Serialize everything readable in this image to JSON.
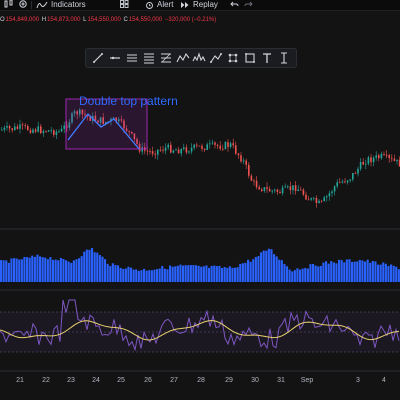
{
  "toolbar": {
    "indicators_label": "Indicators",
    "alert_label": "Alert",
    "replay_label": "Replay"
  },
  "ohlc": {
    "o_label": "O",
    "o_value": "154,849,000",
    "h_label": "H",
    "h_value": "154,873,000",
    "l_label": "L",
    "l_value": "154,550,000",
    "c_label": "C",
    "c_value": "154,550,000",
    "change": "−320,000 (−0.21%)"
  },
  "drawing_tools": [
    "cursor-icon",
    "trend-line-icon",
    "horizontal-ray-icon",
    "parallel-channel-icon",
    "fib-retracement-icon",
    "zigzag-pattern-icon",
    "head-shoulders-icon",
    "path-icon",
    "points-icon",
    "rectangle-icon",
    "text-icon",
    "pin-icon"
  ],
  "annotation": {
    "label": "Double top pattern",
    "color": "#2f6bff",
    "box_color": "#9c27b0"
  },
  "x_axis": {
    "labels": [
      "21",
      "22",
      "23",
      "24",
      "25",
      "26",
      "27",
      "28",
      "29",
      "30",
      "31",
      "Sep",
      "3",
      "4"
    ]
  },
  "colors": {
    "up": "#26a69a",
    "down": "#ef5350",
    "volume": "#2962ff",
    "oscillator_fast": "#7e57c2",
    "oscillator_slow": "#e8d16f",
    "background": "#131314"
  }
}
